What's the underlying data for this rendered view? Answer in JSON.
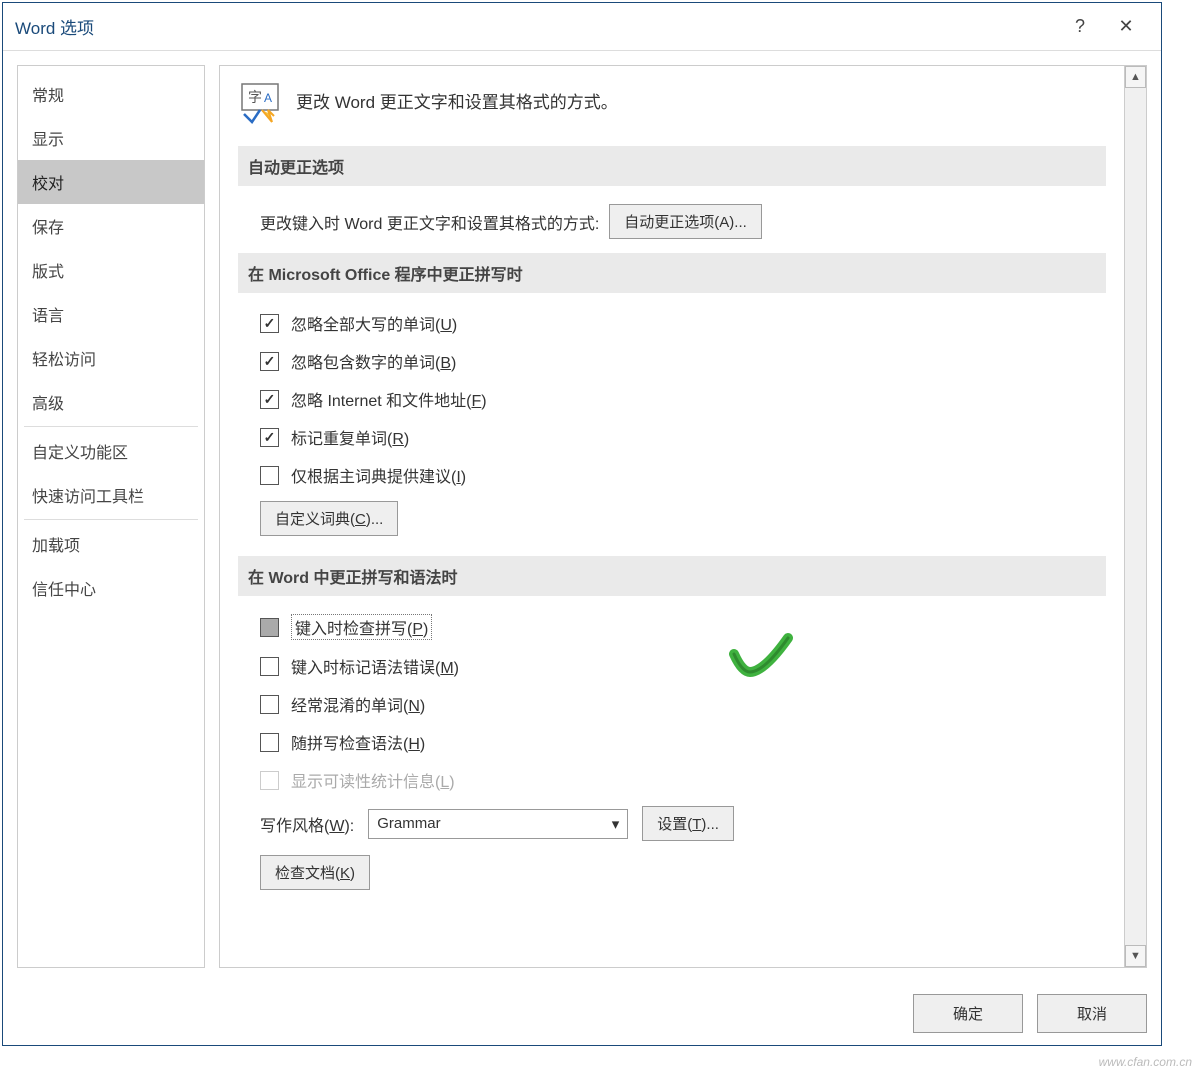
{
  "window": {
    "title": "Word 选项"
  },
  "titlebar": {
    "help": "?",
    "close": "✕"
  },
  "sidebar": {
    "items": [
      {
        "label": "常规"
      },
      {
        "label": "显示"
      },
      {
        "label": "校对",
        "selected": true
      },
      {
        "label": "保存"
      },
      {
        "label": "版式"
      },
      {
        "label": "语言"
      },
      {
        "label": "轻松访问"
      },
      {
        "label": "高级"
      }
    ],
    "items2": [
      {
        "label": "自定义功能区"
      },
      {
        "label": "快速访问工具栏"
      }
    ],
    "items3": [
      {
        "label": "加载项"
      },
      {
        "label": "信任中心"
      }
    ]
  },
  "header": {
    "text": "更改 Word 更正文字和设置其格式的方式。"
  },
  "section1": {
    "title": "自动更正选项",
    "row_text": "更改键入时 Word 更正文字和设置其格式的方式:",
    "button": "自动更正选项(A)..."
  },
  "section2": {
    "title": "在 Microsoft Office 程序中更正拼写时",
    "cb1": {
      "label_pre": "忽略全部大写的单词(",
      "key": "U",
      "label_post": ")"
    },
    "cb2": {
      "label_pre": "忽略包含数字的单词(",
      "key": "B",
      "label_post": ")"
    },
    "cb3": {
      "label_pre": "忽略 Internet 和文件地址(",
      "key": "F",
      "label_post": ")"
    },
    "cb4": {
      "label_pre": "标记重复单词(",
      "key": "R",
      "label_post": ")"
    },
    "cb5": {
      "label_pre": "仅根据主词典提供建议(",
      "key": "I",
      "label_post": ")"
    },
    "dict_btn": {
      "pre": "自定义词典(",
      "key": "C",
      "post": ")..."
    }
  },
  "section3": {
    "title": "在 Word 中更正拼写和语法时",
    "cb1": {
      "label_pre": "键入时检查拼写(",
      "key": "P",
      "label_post": ")"
    },
    "cb2": {
      "label_pre": "键入时标记语法错误(",
      "key": "M",
      "label_post": ")"
    },
    "cb3": {
      "label_pre": "经常混淆的单词(",
      "key": "N",
      "label_post": ")"
    },
    "cb4": {
      "label_pre": "随拼写检查语法(",
      "key": "H",
      "label_post": ")"
    },
    "cb5": {
      "label_pre": "显示可读性统计信息(",
      "key": "L",
      "label_post": ")"
    },
    "style_label": {
      "pre": "写作风格(",
      "key": "W",
      "post": "):"
    },
    "style_value": "Grammar",
    "settings_btn": {
      "pre": "设置(",
      "key": "T",
      "post": ")..."
    },
    "check_btn": {
      "pre": "检查文档(",
      "key": "K",
      "post": ")"
    }
  },
  "footer": {
    "ok": "确定",
    "cancel": "取消"
  },
  "watermark": "www.cfan.com.cn"
}
